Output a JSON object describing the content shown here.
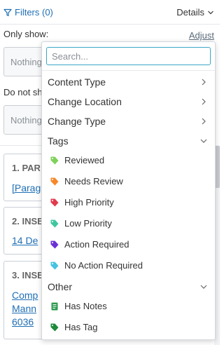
{
  "header": {
    "filters_label": "Filters (0)",
    "details_label": "Details"
  },
  "only_show": {
    "label": "Only show:",
    "adjust_label": "Adjust",
    "placeholder": "Nothing"
  },
  "do_not_show": {
    "label": "Do not sh",
    "placeholder": "Nothing"
  },
  "cards": [
    {
      "title": "1. PAR",
      "links": [
        "[Parag"
      ]
    },
    {
      "title": "2. INSE",
      "links": [
        "14 De"
      ]
    },
    {
      "title": "3. INSE",
      "links": [
        "Comp",
        "Mann",
        "6036"
      ]
    }
  ],
  "dropdown": {
    "search_placeholder": "Search...",
    "categories": [
      {
        "label": "Content Type",
        "chevron": "right"
      },
      {
        "label": "Change Location",
        "chevron": "right"
      },
      {
        "label": "Change Type",
        "chevron": "right"
      },
      {
        "label": "Tags",
        "chevron": "down"
      }
    ],
    "tags": [
      {
        "label": "Reviewed",
        "color": "#7fd15a",
        "icon": "tag-icon"
      },
      {
        "label": "Needs Review",
        "color": "#f5882a",
        "icon": "tag-icon"
      },
      {
        "label": "High Priority",
        "color": "#e23b4e",
        "icon": "tag-icon"
      },
      {
        "label": "Low Priority",
        "color": "#3fc6a0",
        "icon": "tag-icon"
      },
      {
        "label": "Action Required",
        "color": "#6b2fd6",
        "icon": "tag-icon"
      },
      {
        "label": "No Action Required",
        "color": "#45c3e0",
        "icon": "tag-icon"
      }
    ],
    "other": {
      "label": "Other",
      "chevron": "down",
      "items": [
        {
          "label": "Has Notes",
          "color": "#2e9b4f",
          "icon": "note-icon"
        },
        {
          "label": "Has Tag",
          "color": "#1f8a3c",
          "icon": "tag-icon"
        }
      ]
    }
  }
}
